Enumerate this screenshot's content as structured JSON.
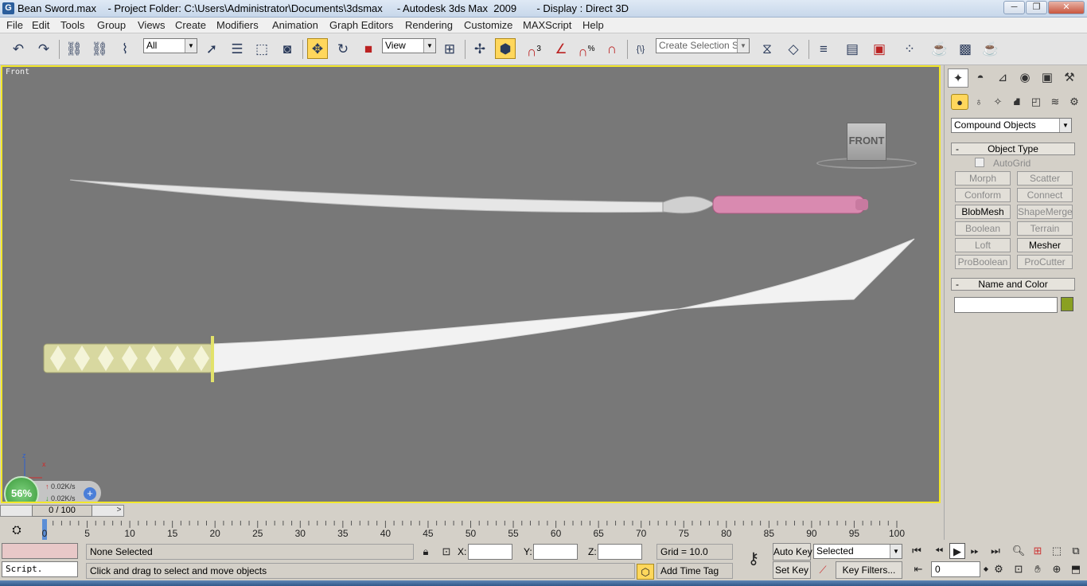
{
  "window": {
    "title": "Bean Sword.max    - Project Folder: C:\\Users\\Administrator\\Documents\\3dsmax     - Autodesk 3ds Max  2009       - Display : Direct 3D",
    "app_icon_letter": "G",
    "controls": [
      "minimize-icon",
      "restore-icon",
      "close-icon"
    ]
  },
  "menu": [
    "File",
    "Edit",
    "Tools",
    "Group",
    "Views",
    "Create",
    "Modifiers",
    "Animation",
    "Graph Editors",
    "Rendering",
    "Customize",
    "MAXScript",
    "Help"
  ],
  "toolbar": {
    "selection_filter": "All",
    "reference_coord": "View",
    "named_selection_placeholder": "Create Selection Set",
    "snap_label": "3",
    "angle_snap_label": "%",
    "active_tool": "select-and-move"
  },
  "viewport": {
    "label": "Front",
    "viewcube_face": "FRONT",
    "axis_labels": [
      "z",
      "x"
    ],
    "network_widget": {
      "percent": "56%",
      "upload_rate": "0.02K/s",
      "download_rate": "0.02K/s"
    },
    "colors": {
      "background": "#787878",
      "active_border": "#f2e72a",
      "sheath_grip": "#d88ab0",
      "handle_wrap": "#d8d8a0"
    }
  },
  "time_slider": {
    "position": "0 / 100",
    "prev": "<",
    "next": ">"
  },
  "trackbar": {
    "labels": [
      "0",
      "5",
      "10",
      "15",
      "20",
      "25",
      "30",
      "35",
      "40",
      "45",
      "50",
      "55",
      "60",
      "65",
      "70",
      "75",
      "80",
      "85",
      "90",
      "95",
      "100"
    ],
    "current_frame": 0
  },
  "status": {
    "selection": "None Selected",
    "prompt": "Click and drag to select and move objects",
    "script_label": "Script.",
    "x_label": "X:",
    "y_label": "Y:",
    "z_label": "Z:",
    "x_value": "",
    "y_value": "",
    "z_value": "",
    "grid": "Grid = 10.0",
    "add_time_tag": "Add Time Tag",
    "auto_key": "Auto Key",
    "set_key": "Set Key",
    "key_mode": "Selected",
    "key_filters": "Key Filters...",
    "frame": "0"
  },
  "command_panel": {
    "tabs": [
      "create",
      "modify",
      "hierarchy",
      "motion",
      "display",
      "utilities"
    ],
    "subtabs": [
      "geometry",
      "shapes",
      "lights",
      "cameras",
      "helpers",
      "space-warps",
      "systems"
    ],
    "category": "Compound Objects",
    "object_type": {
      "title": "Object Type",
      "autogrid": "AutoGrid",
      "buttons": [
        {
          "label": "Morph",
          "enabled": false
        },
        {
          "label": "Scatter",
          "enabled": false
        },
        {
          "label": "Conform",
          "enabled": false
        },
        {
          "label": "Connect",
          "enabled": false
        },
        {
          "label": "BlobMesh",
          "enabled": true
        },
        {
          "label": "ShapeMerge",
          "enabled": false
        },
        {
          "label": "Boolean",
          "enabled": false
        },
        {
          "label": "Terrain",
          "enabled": false
        },
        {
          "label": "Loft",
          "enabled": false
        },
        {
          "label": "Mesher",
          "enabled": true
        },
        {
          "label": "ProBoolean",
          "enabled": false
        },
        {
          "label": "ProCutter",
          "enabled": false
        }
      ]
    },
    "name_and_color": {
      "title": "Name and Color",
      "name_value": "",
      "color": "#8aa022"
    }
  }
}
